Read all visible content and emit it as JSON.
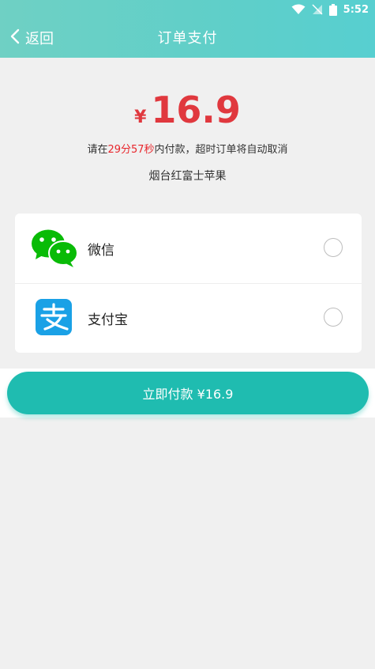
{
  "status_bar": {
    "time": "5:52"
  },
  "header": {
    "back_label": "返回",
    "title": "订单支付"
  },
  "order": {
    "currency": "¥",
    "amount": "16.9",
    "notice_prefix": "请在",
    "countdown": "29分57秒",
    "notice_suffix": "内付款，超时订单将自动取消",
    "product_name": "烟台红富士苹果"
  },
  "payment_methods": [
    {
      "label": "微信",
      "icon": "wechat-icon",
      "color": "#09bb07",
      "selected": false
    },
    {
      "label": "支付宝",
      "icon": "alipay-icon",
      "color": "#1aa1e6",
      "selected": false
    }
  ],
  "pay_button": {
    "label": "立即付款 ¥16.9"
  },
  "colors": {
    "header": "#5fcfc9",
    "accent": "#1fbcb0",
    "price": "#e0383e"
  }
}
